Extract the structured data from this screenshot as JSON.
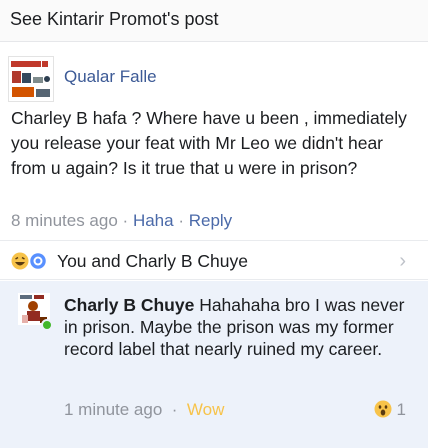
{
  "header": {
    "title": "See Kintarir Promot's post"
  },
  "comment": {
    "author": "Qualar Falle",
    "text": "Charley B hafa ? Where have u been , immediately you release your feat with Mr Leo we didn't hear from u again? Is it true that u were in prison?",
    "time": "8 minutes ago",
    "action_1": "Haha",
    "action_2": "Reply",
    "separator": "·"
  },
  "reactions": {
    "summary": "You and Charly B Chuye",
    "icons": [
      "haha-emoji-icon",
      "like-reaction-icon"
    ],
    "chevron": "›"
  },
  "reply": {
    "author": "Charly B Chuye",
    "text": "Hahahaha bro I was never in prison. Maybe the prison was my former record label that nearly ruined my career.",
    "time": "1 minute ago",
    "separator": "·",
    "action": "Wow",
    "reaction_count": "1"
  },
  "colors": {
    "link_blue": "#3c5a96",
    "meta_gray": "#90949c",
    "reply_bg": "#edf2fa",
    "online_green": "#42b72a",
    "wow_yellow": "#f7c34a"
  }
}
